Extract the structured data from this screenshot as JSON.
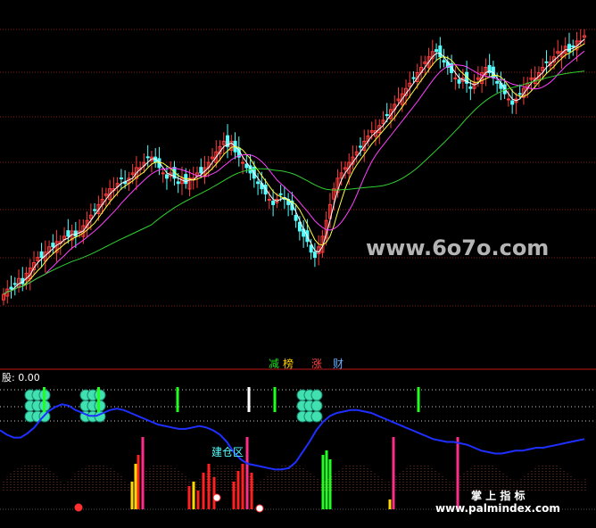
{
  "colors": {
    "background": "#000000",
    "grid": "#8b1a1a",
    "panel_border": "#c01818",
    "candle_up": "#ff3c3c",
    "candle_down": "#55ffff",
    "ma_white": "#ffffff",
    "ma_yellow": "#ffff40",
    "ma_magenta": "#ff40ff",
    "ma_green": "#30d030",
    "blue_line": "#1f2fff",
    "pink_bar": "#ff2d8a",
    "red_bar": "#ff2020",
    "yellow_bar": "#ffd800",
    "green_bar": "#20ff20",
    "white_bar": "#ffffff",
    "teal_icon": "#40e0b0",
    "watermark": "#b4b4b4"
  },
  "watermark_top": "www.6o7o.com",
  "watermark_bottom_cn": "掌 上 指 标",
  "watermark_bottom_url": "www.palmindex.com",
  "legend_tokens": [
    {
      "text": "减",
      "color": "#22dd22"
    },
    {
      "text": "榜",
      "color": "#ffcc00"
    },
    {
      "text": "涨",
      "color": "#ff4040"
    },
    {
      "text": "财",
      "color": "#6ab0ff"
    }
  ],
  "lower_title": "股: 0.00",
  "zone_label": "建仓区",
  "chart_data": [
    {
      "type": "candlestick",
      "title": "",
      "panel": "price",
      "overlays": [
        "MA short (white)",
        "MA mid (yellow)",
        "MA long (magenta)",
        "MA longest (green)"
      ],
      "close_profile": [
        4,
        5,
        5,
        6,
        7,
        6,
        8,
        9,
        10,
        11,
        11,
        12,
        13,
        13,
        14,
        14,
        15,
        15,
        16,
        15,
        16,
        17,
        18,
        19,
        20,
        21,
        22,
        23,
        24,
        24,
        25,
        26,
        25,
        26,
        27,
        28,
        28,
        29,
        30,
        30,
        29,
        28,
        27,
        26,
        27,
        26,
        25,
        26,
        25,
        26,
        26,
        27,
        27,
        28,
        29,
        30,
        31,
        32,
        33,
        32,
        33,
        31,
        30,
        29,
        28,
        27,
        26,
        25,
        24,
        23,
        22,
        21,
        22,
        23,
        22,
        21,
        20,
        18,
        16,
        15,
        14,
        12,
        11,
        13,
        15,
        18,
        21,
        24,
        26,
        27,
        28,
        29,
        30,
        31,
        32,
        33,
        34,
        35,
        35,
        36,
        37,
        38,
        39,
        40,
        41,
        42,
        43,
        44,
        45,
        46,
        47,
        48,
        49,
        50,
        50,
        49,
        48,
        47,
        46,
        45,
        44,
        45,
        44,
        43,
        44,
        45,
        46,
        47,
        46,
        45,
        44,
        43,
        42,
        41,
        40,
        41,
        42,
        43,
        44,
        45,
        45,
        46,
        47,
        48,
        48,
        49,
        50,
        50,
        51,
        50,
        51,
        52,
        52,
        53
      ]
    },
    {
      "type": "bar",
      "title": "",
      "panel": "indicator",
      "blue_line_profile": [
        60,
        57,
        55,
        55,
        58,
        62,
        68,
        73,
        76,
        78,
        77,
        74,
        72,
        70,
        70,
        72,
        74,
        75,
        74,
        72,
        70,
        68,
        66,
        64,
        63,
        62,
        61,
        61,
        62,
        63,
        62,
        60,
        57,
        52,
        45,
        40,
        37,
        36,
        35,
        34,
        33,
        33,
        34,
        38,
        45,
        52,
        60,
        66,
        70,
        72,
        73,
        74,
        74,
        73,
        72,
        70,
        68,
        66,
        64,
        62,
        60,
        58,
        56,
        54,
        53,
        52,
        52,
        51,
        50,
        48,
        46,
        45,
        44,
        44,
        45,
        46,
        46,
        47,
        48,
        48,
        49,
        50,
        51,
        52,
        53,
        54
      ]
    }
  ]
}
